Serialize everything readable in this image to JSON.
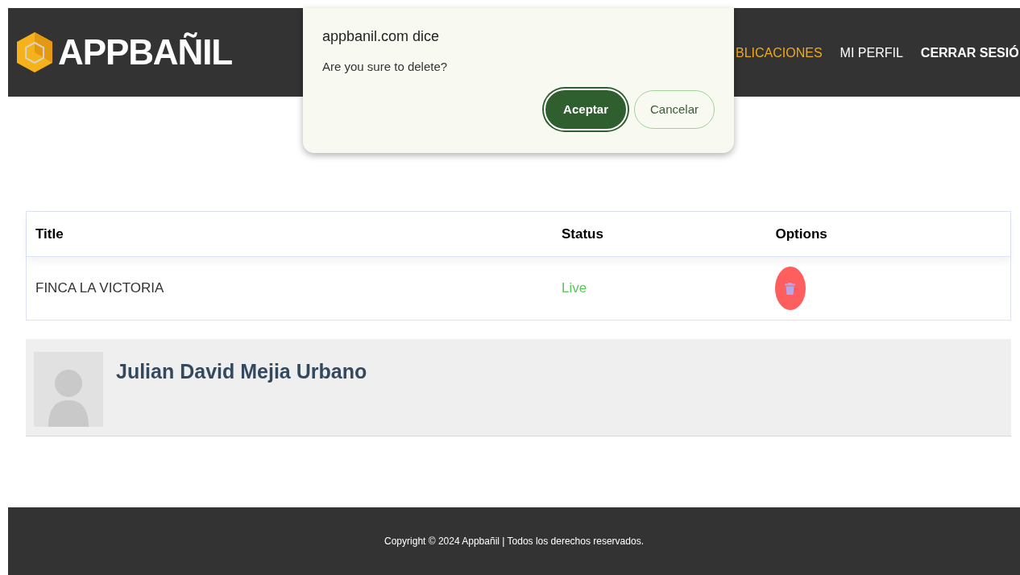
{
  "header": {
    "logo": "APPBAÑIL",
    "nav": [
      {
        "label": "BLICACIONES",
        "selected": true,
        "kind": "link"
      },
      {
        "label": "MI PERFIL",
        "selected": false,
        "kind": "link"
      },
      {
        "label": "CERRAR SESIÓ",
        "selected": false,
        "kind": "logout"
      }
    ]
  },
  "dialog": {
    "title": "appbanil.com dice",
    "message": "Are you sure to delete?",
    "buttons": [
      {
        "label": "Aceptar",
        "kind": "primary"
      },
      {
        "label": "Cancelar",
        "kind": "secondary"
      }
    ]
  },
  "table": {
    "columns": [
      "Title",
      "Status",
      "Options"
    ],
    "rows": [
      {
        "title": "FINCA LA VICTORIA",
        "status": "Live"
      }
    ]
  },
  "profile": {
    "name": "Julian David Mejia Urbano"
  },
  "footer": {
    "copyright": "Copyright © 2024 Appbañil | Todos los derechos reservados."
  }
}
